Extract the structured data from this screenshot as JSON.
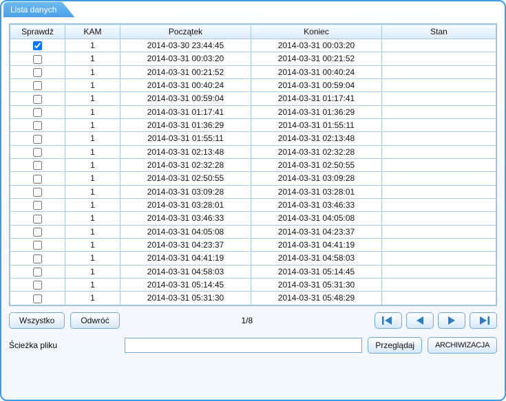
{
  "tab_title": "Lista danych",
  "columns": {
    "check": "Sprawdź",
    "kam": "KAM",
    "start": "Początek",
    "end": "Koniec",
    "stan": "Stan"
  },
  "rows": [
    {
      "checked": true,
      "kam": "1",
      "start": "2014-03-30 23:44:45",
      "end": "2014-03-31 00:03:20",
      "stan": ""
    },
    {
      "checked": false,
      "kam": "1",
      "start": "2014-03-31 00:03:20",
      "end": "2014-03-31 00:21:52",
      "stan": ""
    },
    {
      "checked": false,
      "kam": "1",
      "start": "2014-03-31 00:21:52",
      "end": "2014-03-31 00:40:24",
      "stan": ""
    },
    {
      "checked": false,
      "kam": "1",
      "start": "2014-03-31 00:40:24",
      "end": "2014-03-31 00:59:04",
      "stan": ""
    },
    {
      "checked": false,
      "kam": "1",
      "start": "2014-03-31 00:59:04",
      "end": "2014-03-31 01:17:41",
      "stan": ""
    },
    {
      "checked": false,
      "kam": "1",
      "start": "2014-03-31 01:17:41",
      "end": "2014-03-31 01:36:29",
      "stan": ""
    },
    {
      "checked": false,
      "kam": "1",
      "start": "2014-03-31 01:36:29",
      "end": "2014-03-31 01:55:11",
      "stan": ""
    },
    {
      "checked": false,
      "kam": "1",
      "start": "2014-03-31 01:55:11",
      "end": "2014-03-31 02:13:48",
      "stan": ""
    },
    {
      "checked": false,
      "kam": "1",
      "start": "2014-03-31 02:13:48",
      "end": "2014-03-31 02:32:28",
      "stan": ""
    },
    {
      "checked": false,
      "kam": "1",
      "start": "2014-03-31 02:32:28",
      "end": "2014-03-31 02:50:55",
      "stan": ""
    },
    {
      "checked": false,
      "kam": "1",
      "start": "2014-03-31 02:50:55",
      "end": "2014-03-31 03:09:28",
      "stan": ""
    },
    {
      "checked": false,
      "kam": "1",
      "start": "2014-03-31 03:09:28",
      "end": "2014-03-31 03:28:01",
      "stan": ""
    },
    {
      "checked": false,
      "kam": "1",
      "start": "2014-03-31 03:28:01",
      "end": "2014-03-31 03:46:33",
      "stan": ""
    },
    {
      "checked": false,
      "kam": "1",
      "start": "2014-03-31 03:46:33",
      "end": "2014-03-31 04:05:08",
      "stan": ""
    },
    {
      "checked": false,
      "kam": "1",
      "start": "2014-03-31 04:05:08",
      "end": "2014-03-31 04:23:37",
      "stan": ""
    },
    {
      "checked": false,
      "kam": "1",
      "start": "2014-03-31 04:23:37",
      "end": "2014-03-31 04:41:19",
      "stan": ""
    },
    {
      "checked": false,
      "kam": "1",
      "start": "2014-03-31 04:41:19",
      "end": "2014-03-31 04:58:03",
      "stan": ""
    },
    {
      "checked": false,
      "kam": "1",
      "start": "2014-03-31 04:58:03",
      "end": "2014-03-31 05:14:45",
      "stan": ""
    },
    {
      "checked": false,
      "kam": "1",
      "start": "2014-03-31 05:14:45",
      "end": "2014-03-31 05:31:30",
      "stan": ""
    },
    {
      "checked": false,
      "kam": "1",
      "start": "2014-03-31 05:31:30",
      "end": "2014-03-31 05:48:29",
      "stan": ""
    }
  ],
  "buttons": {
    "all": "Wszystko",
    "invert": "Odwróć",
    "browse": "Przeglądaj",
    "archive": "ARCHIWIZACJA"
  },
  "page_indicator": "1/8",
  "path_label": "Ścieżka pliku",
  "path_value": "",
  "icons": {
    "first": "first-icon",
    "prev": "prev-icon",
    "next": "next-icon",
    "last": "last-icon"
  },
  "colors": {
    "accent": "#3b9de8",
    "navfill": "#2e7bc5"
  }
}
